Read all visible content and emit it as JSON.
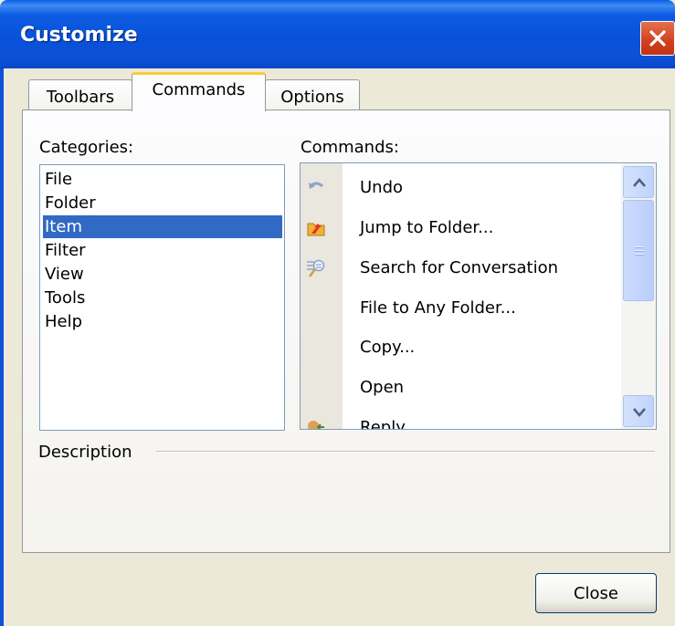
{
  "window": {
    "title": "Customize"
  },
  "tabs": [
    {
      "label": "Toolbars",
      "active": false
    },
    {
      "label": "Commands",
      "active": true
    },
    {
      "label": "Options",
      "active": false
    }
  ],
  "categories": {
    "label": "Categories:",
    "items": [
      "File",
      "Folder",
      "Item",
      "Filter",
      "View",
      "Tools",
      "Help"
    ],
    "selected": "Item"
  },
  "commands": {
    "label": "Commands:",
    "items": [
      {
        "label": "Undo",
        "icon": "undo-icon"
      },
      {
        "label": "Jump to Folder...",
        "icon": "jump-to-folder-icon"
      },
      {
        "label": "Search for Conversation",
        "icon": "search-conversation-icon"
      },
      {
        "label": "File to Any Folder...",
        "icon": ""
      },
      {
        "label": "Copy...",
        "icon": ""
      },
      {
        "label": "Open",
        "icon": ""
      },
      {
        "label": "Reply",
        "icon": "reply-icon"
      }
    ]
  },
  "description": {
    "label": "Description"
  },
  "footer": {
    "close_label": "Close"
  },
  "colors": {
    "titlebar": "#0b52d8",
    "selection": "#316ac5",
    "active_tab_accent": "#ffc83c",
    "close_x": "#d1401d"
  }
}
